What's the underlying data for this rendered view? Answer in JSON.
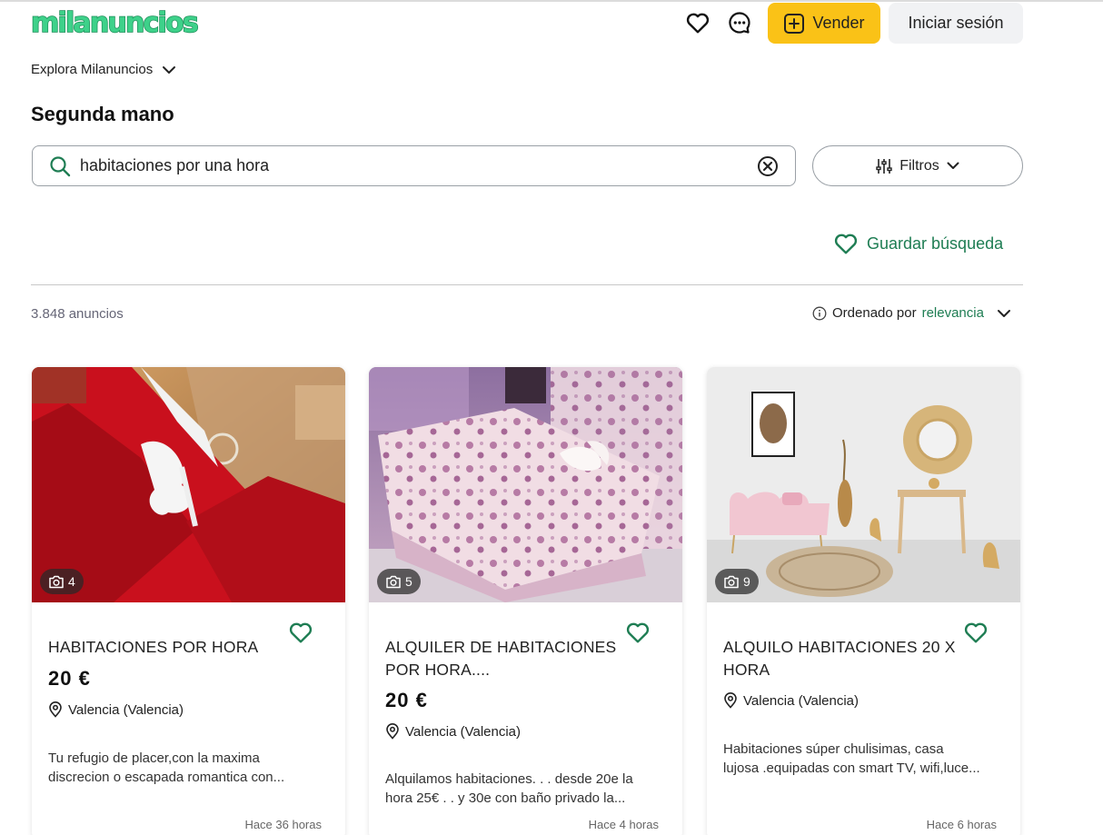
{
  "header": {
    "logo": "milanuncios",
    "sell_label": "Vender",
    "login_label": "Iniciar sesión"
  },
  "explore": {
    "label": "Explora Milanuncios"
  },
  "section_title": "Segunda mano",
  "search": {
    "value": "habitaciones por una hora"
  },
  "filters": {
    "label": "Filtros"
  },
  "save_search": {
    "label": "Guardar búsqueda"
  },
  "results": {
    "count": "3.848 anuncios",
    "sort_prefix": "Ordenado por",
    "sort_value": "relevancia"
  },
  "colors": {
    "brand_green": "#1e7d53",
    "sell_yellow": "#fac217"
  },
  "icons": {
    "favorites": "heart-icon",
    "messages": "chat-bubble-icon",
    "sell": "plus-square-icon",
    "search": "search-icon",
    "clear": "clear-circle-icon",
    "filters": "sliders-icon",
    "location": "location-pin-icon",
    "camera": "camera-icon"
  },
  "listings": [
    {
      "title": "HABITACIONES POR HORA",
      "price": "20 €",
      "location": "Valencia (Valencia)",
      "desc_line1": "Tu refugio de placer,con la maxima",
      "desc_line2": "discrecion o escapada romantica con...",
      "photo_count": "4",
      "time": "Hace 36 horas"
    },
    {
      "title": "ALQUILER DE HABITACIONES POR HORA....",
      "price": "20 €",
      "location": "Valencia (Valencia)",
      "desc_line1": "Alquilamos habitaciones. . . desde 20e la",
      "desc_line2": "hora 25€ . . y 30e con baño privado la...",
      "photo_count": "5",
      "time": "Hace 4 horas"
    },
    {
      "title": "ALQUILO HABITACIONES 20 X HORA",
      "price": "",
      "location": "Valencia (Valencia)",
      "desc_line1": "Habitaciones súper chulisimas, casa",
      "desc_line2": "lujosa .equipadas con smart TV, wifi,luce...",
      "photo_count": "9",
      "time": "Hace 6 horas"
    }
  ]
}
